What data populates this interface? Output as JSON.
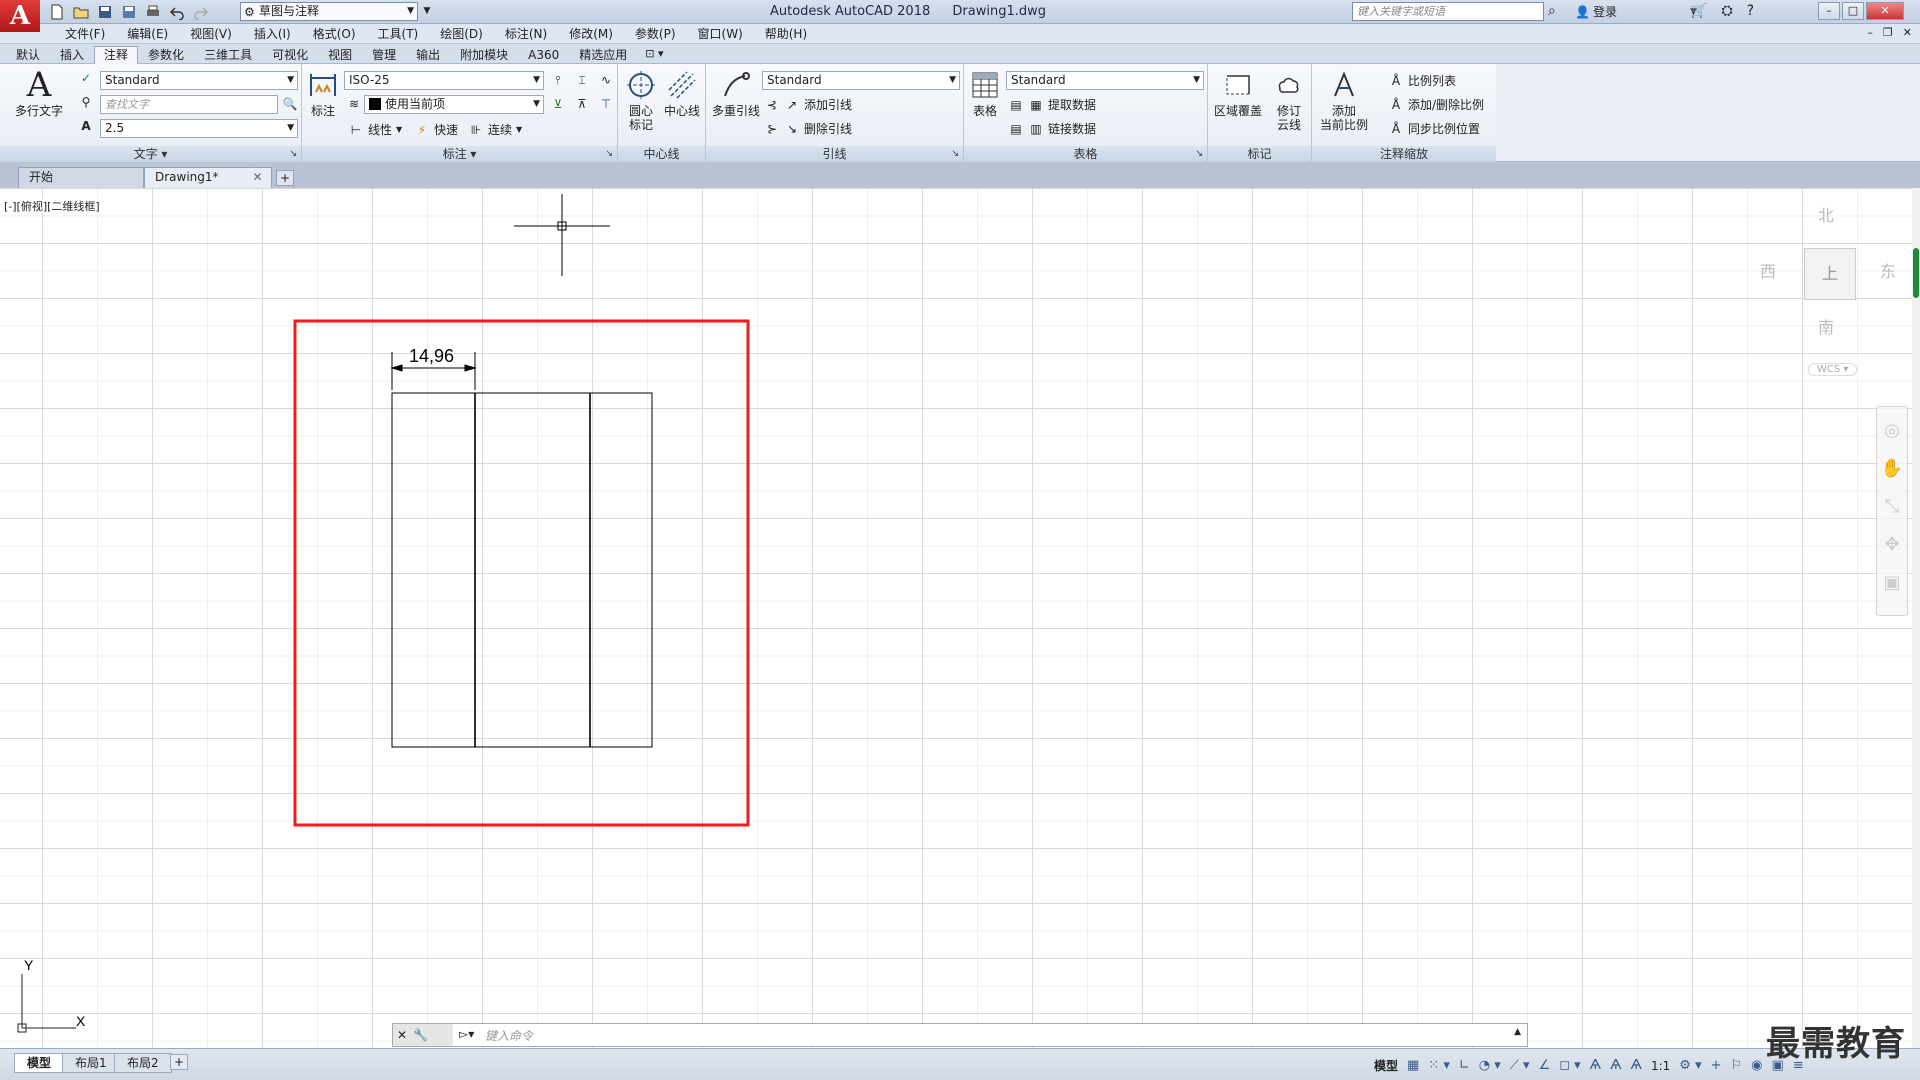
{
  "title_bar": {
    "app_name": "Autodesk AutoCAD 2018",
    "file_name": "Drawing1.dwg",
    "workspace": "草图与注释",
    "search_placeholder": "键入关键字或短语",
    "login": "登录"
  },
  "menu": {
    "items": [
      "文件(F)",
      "编辑(E)",
      "视图(V)",
      "插入(I)",
      "格式(O)",
      "工具(T)",
      "绘图(D)",
      "标注(N)",
      "修改(M)",
      "参数(P)",
      "窗口(W)",
      "帮助(H)"
    ]
  },
  "ribbon_tabs": {
    "items": [
      "默认",
      "插入",
      "注释",
      "参数化",
      "三维工具",
      "可视化",
      "视图",
      "管理",
      "输出",
      "附加模块",
      "A360",
      "精选应用"
    ],
    "active_index": 2
  },
  "ribbon": {
    "text_panel": {
      "title": "文字",
      "mtext": "多行文字",
      "style": "Standard",
      "find_placeholder": "查找文字",
      "height": "2.5"
    },
    "dim_panel": {
      "title": "标注",
      "dim": "标注",
      "style": "ISO-25",
      "layer": "使用当前项",
      "linear": "线性",
      "quick": "快速",
      "continue": "连续"
    },
    "centerline_panel": {
      "title": "中心线",
      "center_mark_1": "圆心",
      "center_mark_2": "标记",
      "centerline": "中心线"
    },
    "leader_panel": {
      "title": "引线",
      "mleader": "多重引线",
      "style": "Standard",
      "add": "添加引线",
      "remove": "删除引线"
    },
    "table_panel": {
      "title": "表格",
      "table": "表格",
      "style": "Standard",
      "extract": "提取数据",
      "link": "链接数据"
    },
    "markup_panel": {
      "title": "标记",
      "wipeout": "区域覆盖",
      "revcloud_1": "修订",
      "revcloud_2": "云线"
    },
    "scale_panel": {
      "title": "注释缩放",
      "add_current_1": "添加",
      "add_current_2": "当前比例",
      "scale_list": "比例列表",
      "add_delete": "添加/删除比例",
      "sync": "同步比例位置"
    }
  },
  "doc_tabs": {
    "start": "开始",
    "drawing": "Drawing1*"
  },
  "viewport": {
    "label": "[-][俯视][二维线框]",
    "dimension_text": "14,96"
  },
  "viewcube": {
    "north": "北",
    "south": "南",
    "east": "东",
    "west": "西",
    "face": "上",
    "wcs": "WCS"
  },
  "command": {
    "placeholder": "键入命令"
  },
  "status": {
    "layouts": [
      "模型",
      "布局1",
      "布局2"
    ],
    "model_label": "模型",
    "scale": "1:1"
  },
  "watermark": "最需教育",
  "colors": {
    "highlight_box": "#ee1c1c",
    "accent": "#1f8a3a",
    "title_bg": "#c3d0e2"
  }
}
